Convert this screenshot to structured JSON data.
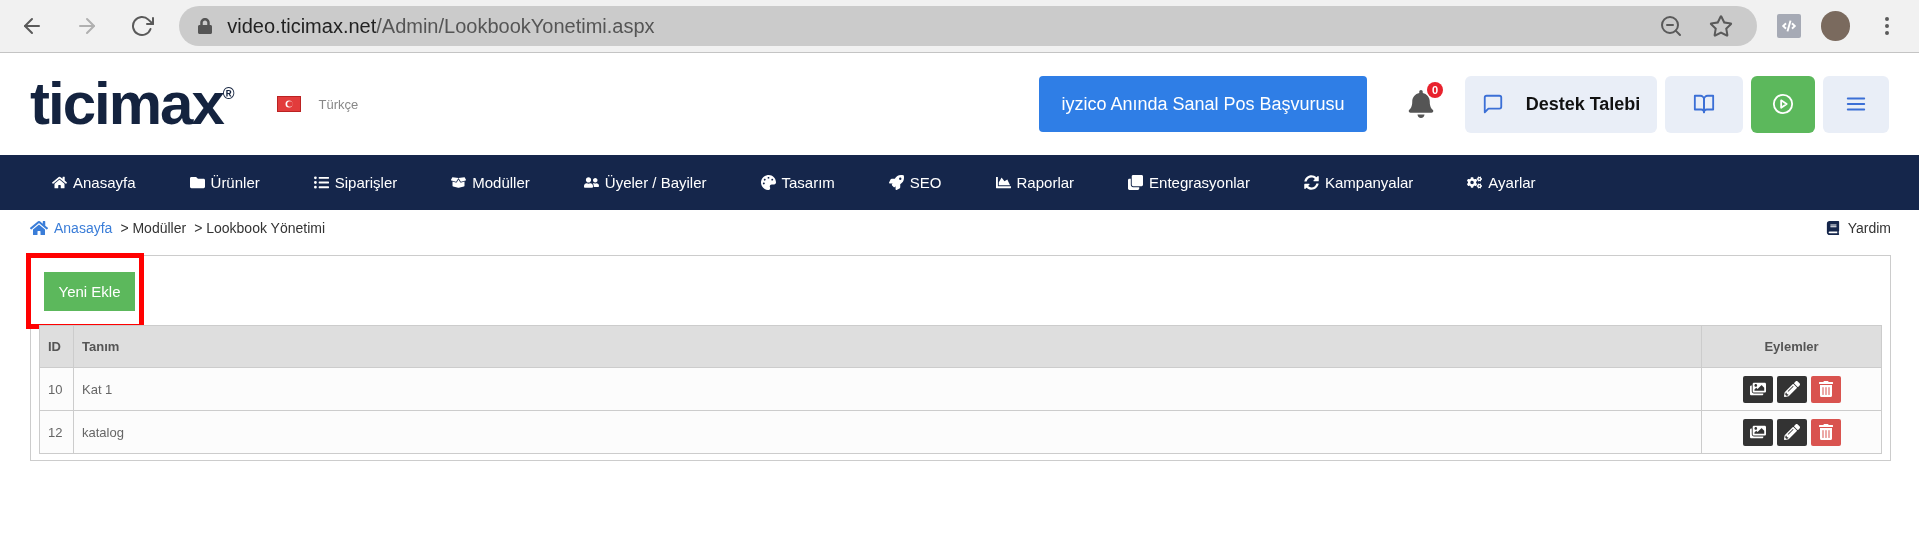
{
  "browser": {
    "url_host": "video.ticimax.net",
    "url_path": "/Admin/LookbookYonetimi.aspx"
  },
  "header": {
    "logo": "ticimax",
    "logo_mark": "®",
    "language": "Türkçe",
    "promo_button": "iyzico Anında Sanal Pos Başvurusu",
    "notifications": "0",
    "support_button": "Destek Talebi"
  },
  "nav": [
    {
      "label": "Anasayfa"
    },
    {
      "label": "Ürünler"
    },
    {
      "label": "Siparişler"
    },
    {
      "label": "Modüller"
    },
    {
      "label": "Üyeler / Bayiler"
    },
    {
      "label": "Tasarım"
    },
    {
      "label": "SEO"
    },
    {
      "label": "Raporlar"
    },
    {
      "label": "Entegrasyonlar"
    },
    {
      "label": "Kampanyalar"
    },
    {
      "label": "Ayarlar"
    }
  ],
  "breadcrumb": {
    "home": "Anasayfa",
    "items": [
      "> Modüller",
      "> Lookbook Yönetimi"
    ],
    "help": "Yardim"
  },
  "add_button": "Yeni Ekle",
  "table": {
    "columns": [
      "ID",
      "Tanım",
      "Eylemler"
    ],
    "rows": [
      {
        "id": "10",
        "name": "Kat 1"
      },
      {
        "id": "12",
        "name": "katalog"
      }
    ]
  }
}
